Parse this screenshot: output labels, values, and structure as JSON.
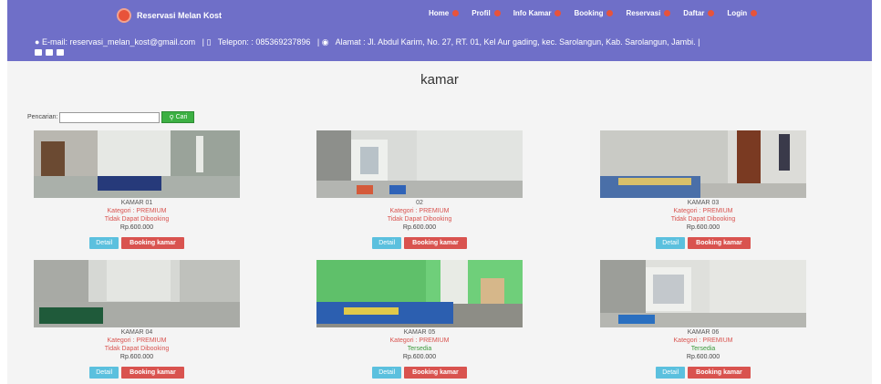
{
  "brand": {
    "name": "Reservasi Melan Kost"
  },
  "nav": [
    {
      "label": "Home"
    },
    {
      "label": "Profil"
    },
    {
      "label": "Info Kamar"
    },
    {
      "label": "Booking"
    },
    {
      "label": "Reservasi"
    },
    {
      "label": "Daftar"
    },
    {
      "label": "Login"
    }
  ],
  "info": {
    "email": "E-mail: reservasi_melan_kost@gmail.com",
    "telepon": "Telepon: : 085369237896",
    "alamat": "Alamat : Jl. Abdul Karim, No. 27, RT. 01, Kel Aur gading, kec. Sarolangun, Kab. Sarolangun, Jambi. |"
  },
  "page": {
    "title": "kamar"
  },
  "search": {
    "label": "Pencarian:",
    "value": "",
    "button": "Cari"
  },
  "buttons": {
    "detail": "Detail",
    "booking": "Booking kamar"
  },
  "rooms": [
    {
      "name": "KAMAR 01",
      "category": "Kategori : PREMIUM",
      "status": "Tidak Dapat Dibooking",
      "available": false,
      "price": "Rp.600.000"
    },
    {
      "name": "02",
      "category": "Kategori : PREMIUM",
      "status": "Tidak Dapat Dibooking",
      "available": false,
      "price": "Rp.600.000"
    },
    {
      "name": "KAMAR 03",
      "category": "Kategori : PREMIUM",
      "status": "Tidak Dapat Dibooking",
      "available": false,
      "price": "Rp.600.000"
    },
    {
      "name": "KAMAR 04",
      "category": "Kategori : PREMIUM",
      "status": "Tidak Dapat Dibooking",
      "available": false,
      "price": "Rp.600.000"
    },
    {
      "name": "KAMAR 05",
      "category": "Kategori : PREMIUM",
      "status": "Tersedia",
      "available": true,
      "price": "Rp.600.000"
    },
    {
      "name": "KAMAR 06",
      "category": "Kategori : PREMIUM",
      "status": "Tersedia",
      "available": true,
      "price": "Rp.600.000"
    }
  ],
  "colors": {
    "nav_bg": "#6f6fc8",
    "accent_red": "#d9534f",
    "accent_blue": "#5bc0de",
    "accent_green": "#3cb043"
  }
}
